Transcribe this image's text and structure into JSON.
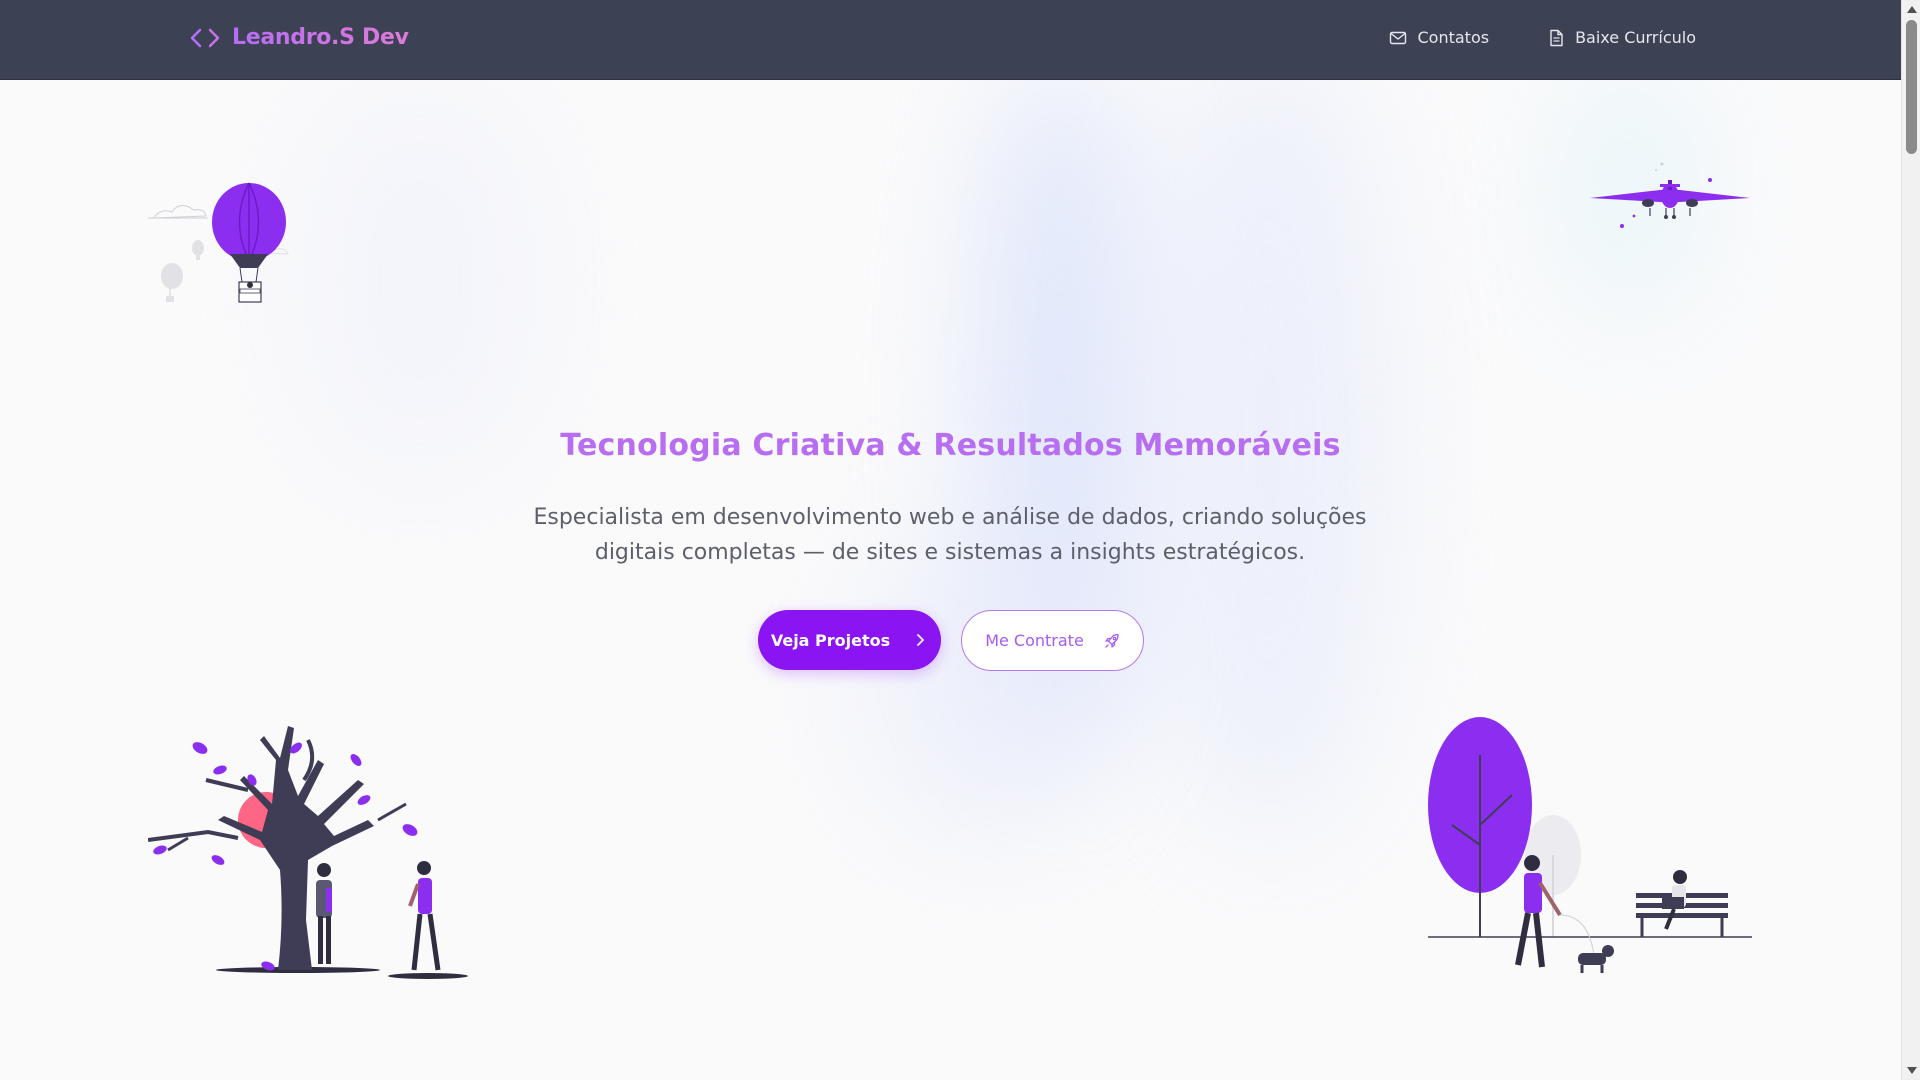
{
  "brand": {
    "name": "Leandro.S Dev",
    "icon": "code-brackets-icon"
  },
  "nav": {
    "items": [
      {
        "label": "Contatos",
        "icon": "mail-icon"
      },
      {
        "label": "Baixe Currículo",
        "icon": "document-icon"
      }
    ]
  },
  "hero": {
    "title": "Tecnologia Criativa & Resultados Memoráveis",
    "subtitle": "Especialista em desenvolvimento web e análise de dados, criando soluções digitais completas — de sites e sistemas a insights estratégicos.",
    "primary_button": {
      "label": "Veja Projetos",
      "icon": "chevron-right-icon"
    },
    "secondary_button": {
      "label": "Me Contrate",
      "icon": "rocket-icon"
    }
  },
  "colors": {
    "accent": "#8a14f2",
    "title": "#b86ef0",
    "header_bg": "#3c4154",
    "illustration_purple": "#8c2ef0"
  }
}
